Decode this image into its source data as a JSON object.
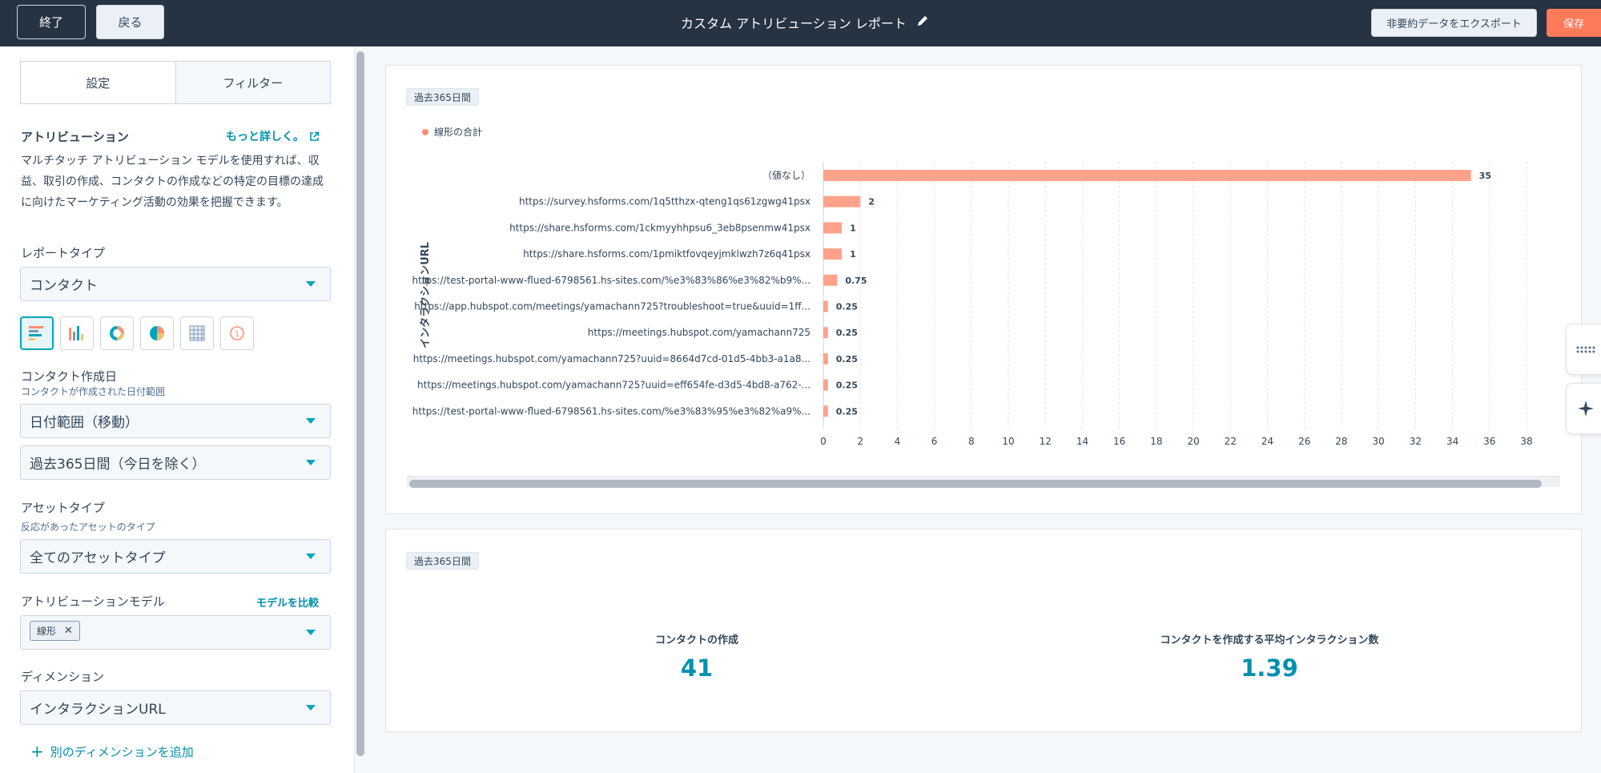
{
  "topbar": {
    "exit_label": "終了",
    "back_label": "戻る",
    "title": "カスタム アトリビューション レポート",
    "export_label": "非要約データをエクスポート",
    "save_label": "保存"
  },
  "left": {
    "tabs": [
      "設定",
      "フィルター"
    ],
    "attribution": {
      "title": "アトリビューション",
      "learn_more": "もっと詳しく。",
      "description": "マルチタッチ アトリビューション モデルを使用すれば、収益、取引の作成、コンタクトの作成などの特定の目標の達成に向けたマーケティング活動の効果を把握できます。"
    },
    "report_type": {
      "label": "レポートタイプ",
      "value": "コンタクト"
    },
    "chart_types": [
      "horizontal-bar-icon",
      "vertical-bar-icon",
      "donut-icon",
      "pie-icon",
      "table-icon",
      "kpi-icon"
    ],
    "contact_created": {
      "label": "コンタクト作成日",
      "sublabel": "コンタクトが作成された日付範囲",
      "range_type": "日付範囲（移動）",
      "range_value": "過去365日間（今日を除く）"
    },
    "asset_type": {
      "label": "アセットタイプ",
      "sublabel": "反応があったアセットのタイプ",
      "value": "全てのアセットタイプ"
    },
    "attribution_model": {
      "label": "アトリビューションモデル",
      "compare": "モデルを比較",
      "tag": "線形"
    },
    "dimension": {
      "label": "ディメンション",
      "value": "インタラクションURL",
      "add": "別のディメンションを追加"
    }
  },
  "card1": {
    "period": "過去365日間",
    "legend": "線形の合計"
  },
  "card2": {
    "period": "過去365日間",
    "kpis": [
      {
        "label": "コンタクトの作成",
        "value": "41"
      },
      {
        "label": "コンタクトを作成する平均インタラクション数",
        "value": "1.39"
      }
    ]
  },
  "chart_data": {
    "type": "bar",
    "orientation": "horizontal",
    "categories": [
      "（値なし）",
      "https://survey.hsforms.com/1q5tthzx-qteng1qs61zgwg41psx",
      "https://share.hsforms.com/1ckmyyhhpsu6_3eb8psenmw41psx",
      "https://share.hsforms.com/1pmiktfovqeyjmklwzh7z6q41psx",
      "https://test-portal-www-flued-6798561.hs-sites.com/%e3%83%86%e3%82%b9%...",
      "https://app.hubspot.com/meetings/yamachann725?troubleshoot=true&uuid=1ff...",
      "https://meetings.hubspot.com/yamachann725",
      "https://meetings.hubspot.com/yamachann725?uuid=8664d7cd-01d5-4bb3-a1a8...",
      "https://meetings.hubspot.com/yamachann725?uuid=eff654fe-d3d5-4bd8-a762-...",
      "https://test-portal-www-flued-6798561.hs-sites.com/%e3%83%95%e3%82%a9%..."
    ],
    "values": [
      35,
      2,
      1,
      1,
      0.75,
      0.25,
      0.25,
      0.25,
      0.25,
      0.25
    ],
    "value_labels": [
      "35",
      "2",
      "1",
      "1",
      "0.75",
      "0.25",
      "0.25",
      "0.25",
      "0.25",
      "0.25"
    ],
    "series": [
      {
        "name": "線形の合計",
        "values": [
          35,
          2,
          1,
          1,
          0.75,
          0.25,
          0.25,
          0.25,
          0.25,
          0.25
        ]
      }
    ],
    "xlabel": "線形の合計",
    "ylabel": "インタラクションURL",
    "xlim": [
      0,
      38
    ],
    "xticks": [
      0,
      2,
      4,
      6,
      8,
      10,
      12,
      14,
      16,
      18,
      20,
      22,
      24,
      26,
      28,
      30,
      32,
      34,
      36,
      38
    ],
    "grid": true,
    "legend_position": "top-left",
    "bar_color": "#ffa28b"
  }
}
